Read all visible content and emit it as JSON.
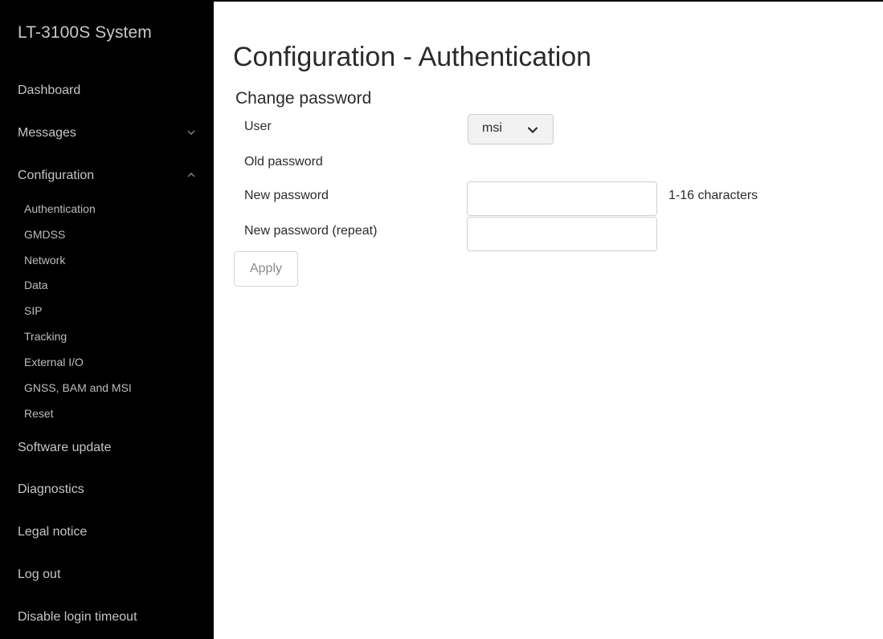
{
  "sidebar": {
    "brand": "LT-3100S System",
    "items": [
      {
        "label": "Dashboard"
      },
      {
        "label": "Messages",
        "expanded": false
      },
      {
        "label": "Configuration",
        "expanded": true
      },
      {
        "label": "Software update"
      },
      {
        "label": "Diagnostics"
      },
      {
        "label": "Legal notice"
      },
      {
        "label": "Log out"
      },
      {
        "label": "Disable login timeout"
      }
    ],
    "config_subitems": [
      {
        "label": "Authentication"
      },
      {
        "label": "GMDSS"
      },
      {
        "label": "Network"
      },
      {
        "label": "Data"
      },
      {
        "label": "SIP"
      },
      {
        "label": "Tracking"
      },
      {
        "label": "External I/O"
      },
      {
        "label": "GNSS, BAM and MSI"
      },
      {
        "label": "Reset"
      }
    ]
  },
  "main": {
    "title": "Configuration - Authentication",
    "section_title": "Change password",
    "fields": {
      "user_label": "User",
      "user_value": "msi",
      "old_password_label": "Old password",
      "new_password_label": "New password",
      "new_password_value": "",
      "new_password_hint": "1-16 characters",
      "repeat_password_label": "New password (repeat)",
      "repeat_password_value": ""
    },
    "apply_label": "Apply"
  },
  "icons": {
    "messages_chevron": "chevron-down-icon",
    "configuration_chevron": "chevron-up-icon",
    "select_chevron": "chevron-down-icon"
  },
  "colors": {
    "sidebar_bg": "#000000",
    "sidebar_text": "#c6c6c6",
    "page_bg": "#ffffff",
    "text": "#2b2b2b",
    "select_bg": "#f2f2f2"
  }
}
